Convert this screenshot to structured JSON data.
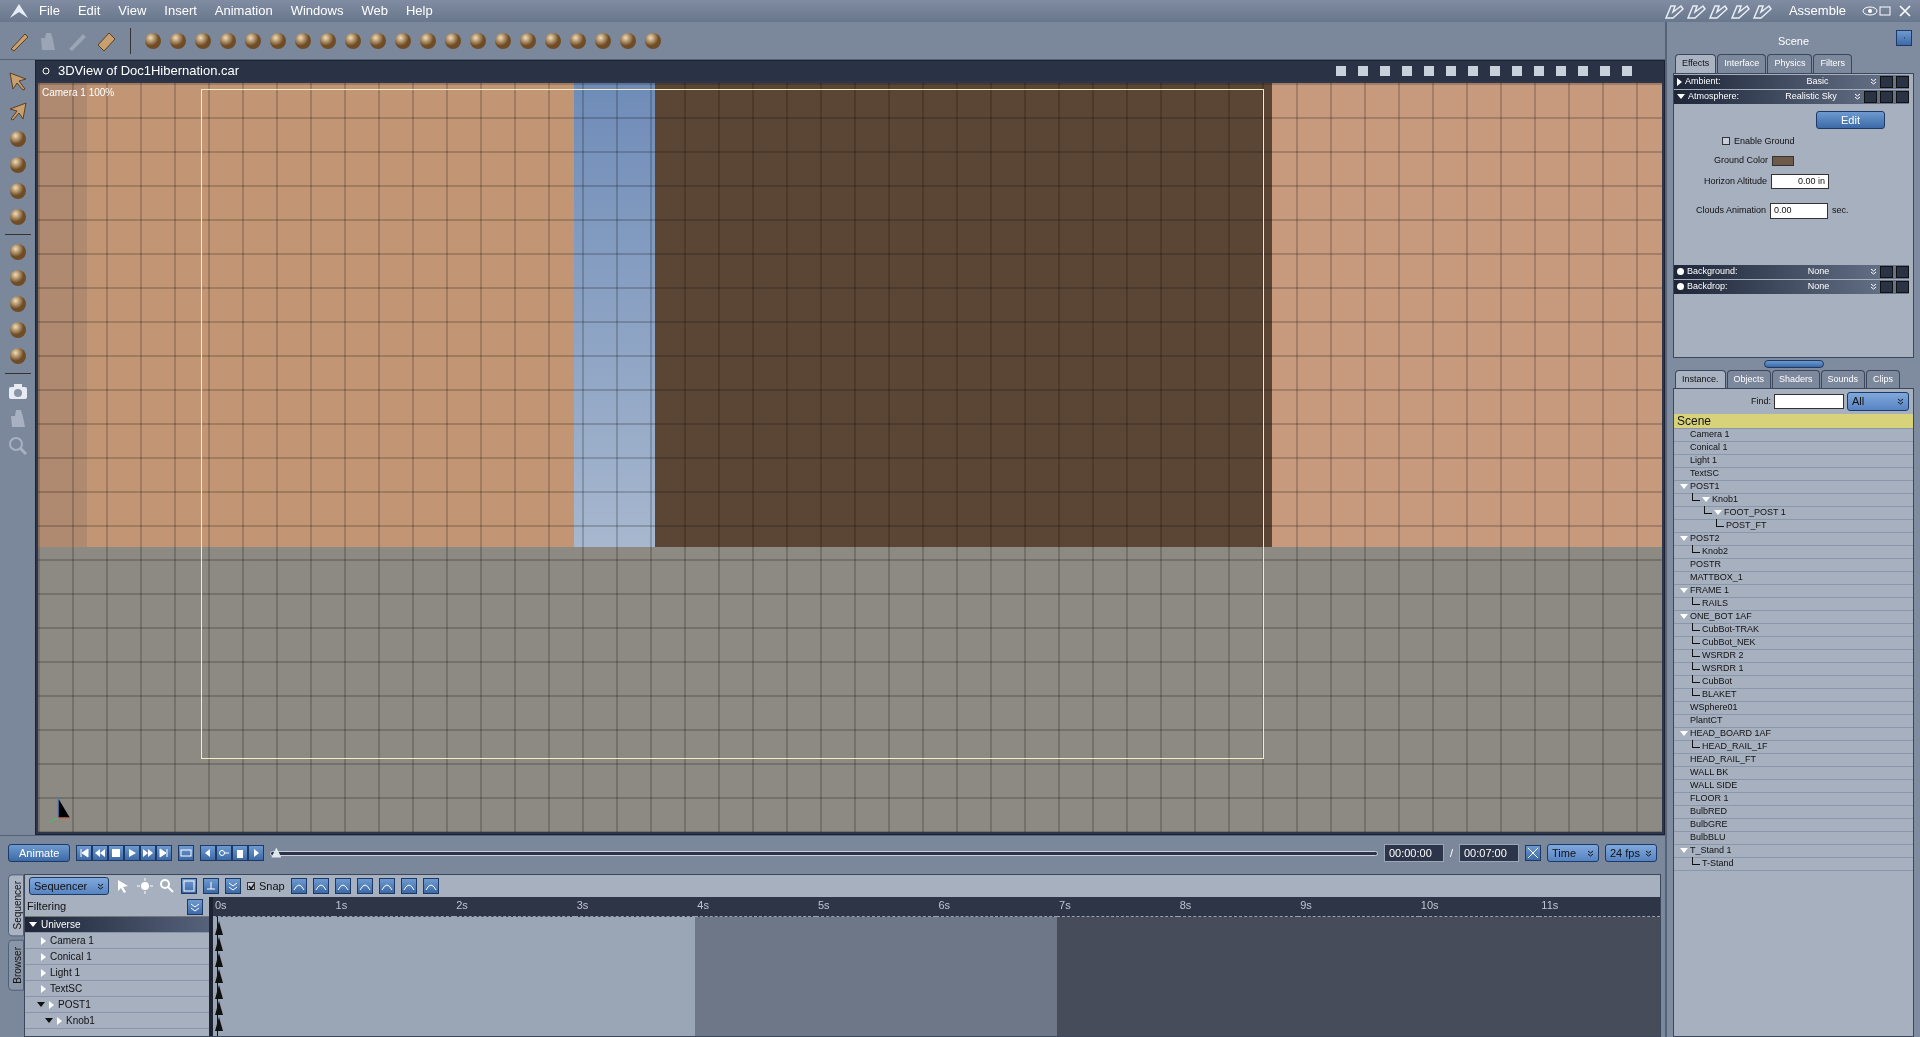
{
  "menu": [
    {
      "label": "File"
    },
    {
      "label": "Edit"
    },
    {
      "label": "View"
    },
    {
      "label": "Insert"
    },
    {
      "label": "Animation"
    },
    {
      "label": "Windows"
    },
    {
      "label": "Web"
    },
    {
      "label": "Help"
    }
  ],
  "room": {
    "label": "Assemble"
  },
  "viewport": {
    "title": "3DView of Doc1Hibernation.car",
    "camera_label": "Camera 1 100%"
  },
  "properties": {
    "title": "Scene",
    "tabs": [
      {
        "label": "Effects",
        "selected": true
      },
      {
        "label": "Interface",
        "selected": false
      },
      {
        "label": "Physics",
        "selected": false
      },
      {
        "label": "Filters",
        "selected": false
      }
    ],
    "sections": [
      {
        "kind": "expander",
        "label": "Ambient:",
        "value": "Basic",
        "expanded": false
      },
      {
        "kind": "expander",
        "label": "Atmosphere:",
        "value": "Realistic Sky",
        "expanded": true
      },
      {
        "kind": "bullet",
        "label": "Background:",
        "value": "None"
      },
      {
        "kind": "bullet",
        "label": "Backdrop:",
        "value": "None"
      }
    ],
    "atmosphere": {
      "edit_button": "Edit",
      "enable_ground": {
        "label": "Enable Ground",
        "checked": false
      },
      "ground_color_label": "Ground Color",
      "horizon_altitude": {
        "label": "Horizon Altitude",
        "value": "0.00 in"
      },
      "clouds_animation": {
        "label": "Clouds Animation",
        "value": "0.00",
        "unit": "sec."
      }
    }
  },
  "browser": {
    "tabs": [
      {
        "label": "Instance.",
        "selected": true
      },
      {
        "label": "Objects",
        "selected": false
      },
      {
        "label": "Shaders",
        "selected": false
      },
      {
        "label": "Sounds",
        "selected": false
      },
      {
        "label": "Clips",
        "selected": false
      }
    ],
    "find_label": "Find:",
    "filter": "All",
    "root": {
      "label": "Scene",
      "selected": true
    },
    "tree": [
      {
        "label": "Camera 1",
        "selected": false
      },
      {
        "label": "Conical 1",
        "selected": false
      },
      {
        "label": "Light 1",
        "selected": false
      },
      {
        "label": "TextSC",
        "selected": false
      },
      {
        "label": "POST1",
        "selected": false,
        "expanded": true,
        "children": [
          {
            "label": "Knob1",
            "selected": false,
            "expanded": true,
            "children": [
              {
                "label": "FOOT_POST 1",
                "selected": false,
                "expanded": true,
                "children": [
                  {
                    "label": "POST_FT",
                    "selected": false
                  }
                ]
              }
            ]
          }
        ]
      },
      {
        "label": "POST2",
        "selected": false,
        "expanded": true,
        "children": [
          {
            "label": "Knob2",
            "selected": false
          }
        ]
      },
      {
        "label": "POSTR",
        "selected": false
      },
      {
        "label": "MATTBOX_1",
        "selected": false
      },
      {
        "label": "FRAME 1",
        "selected": false,
        "expanded": true,
        "children": [
          {
            "label": "RAILS",
            "selected": false
          }
        ]
      },
      {
        "label": "ONE_BOT 1AF",
        "selected": false,
        "expanded": true,
        "children": [
          {
            "label": "CubBot-TRAK",
            "selected": false
          },
          {
            "label": "CubBot_NEK",
            "selected": false
          },
          {
            "label": "WSRDR 2",
            "selected": false
          },
          {
            "label": "WSRDR 1",
            "selected": false
          },
          {
            "label": "CubBot",
            "selected": false
          },
          {
            "label": "BLAKET",
            "selected": false
          }
        ]
      },
      {
        "label": "WSphere01",
        "selected": false
      },
      {
        "label": "PlantCT",
        "selected": false
      },
      {
        "label": "HEAD_BOARD 1AF",
        "selected": false,
        "expanded": true,
        "children": [
          {
            "label": "HEAD_RAIL_1F",
            "selected": false
          }
        ]
      },
      {
        "label": "HEAD_RAIL_FT",
        "selected": false
      },
      {
        "label": "WALL  BK",
        "selected": false
      },
      {
        "label": "WALL SIDE",
        "selected": false
      },
      {
        "label": "FLOOR 1",
        "selected": false
      },
      {
        "label": "BulbRED",
        "selected": false
      },
      {
        "label": "BulbGRE",
        "selected": false
      },
      {
        "label": "BulbBLU",
        "selected": false
      },
      {
        "label": "T_Stand 1",
        "selected": false,
        "expanded": true,
        "children": [
          {
            "label": "T-Stand",
            "selected": false
          }
        ]
      }
    ]
  },
  "timeline": {
    "animate_button": "Animate",
    "current_time": "00:00:00",
    "separator": "/",
    "total_time": "00:07:00",
    "time_slider": {
      "level": 0
    },
    "time_unit": "Time",
    "frame_rate": "24 fps"
  },
  "sequencer": {
    "side_tabs": [
      {
        "label": "Sequencer",
        "selected": true
      },
      {
        "label": "Browser",
        "selected": false
      }
    ],
    "mode": "Sequencer",
    "snap": {
      "label": "Snap",
      "checked": true
    },
    "filtering": "Filtering",
    "ruler": [
      {
        "label": "0s"
      },
      {
        "label": "1s"
      },
      {
        "label": "2s"
      },
      {
        "label": "3s"
      },
      {
        "label": "4s"
      },
      {
        "label": "5s"
      },
      {
        "label": "6s"
      },
      {
        "label": "7s"
      },
      {
        "label": "8s"
      },
      {
        "label": "9s"
      },
      {
        "label": "10s"
      },
      {
        "label": "11s"
      }
    ],
    "tracks": [
      {
        "kind": "group",
        "label": "Universe",
        "expanded": true,
        "children": [
          {
            "kind": "object",
            "label": "Camera 1",
            "expanded": false
          },
          {
            "kind": "object",
            "label": "Conical 1",
            "expanded": false
          },
          {
            "kind": "object",
            "label": "Light 1",
            "expanded": false
          },
          {
            "kind": "object",
            "label": "TextSC",
            "expanded": false
          },
          {
            "kind": "object",
            "label": "POST1",
            "expanded": true,
            "children": [
              {
                "kind": "object",
                "label": "Knob1",
                "expanded": true
              }
            ]
          }
        ]
      }
    ]
  }
}
